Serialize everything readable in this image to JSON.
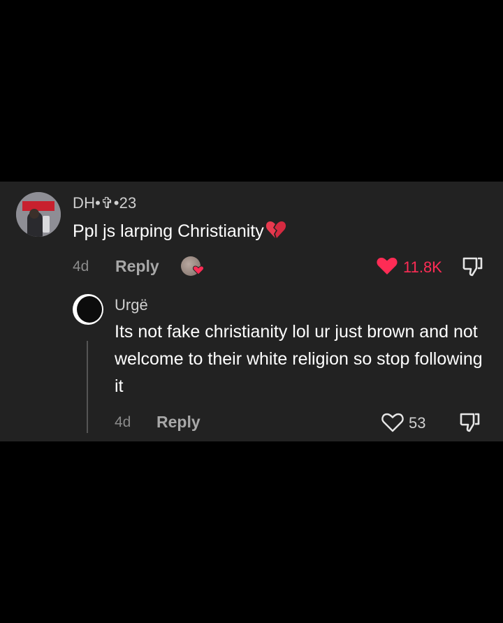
{
  "comment": {
    "username": "DH•✞•23",
    "text": "Ppl js larping Christianity",
    "text_emoji": "broken-heart-icon",
    "time": "4d",
    "reply_label": "Reply",
    "likes": "11.8K",
    "liked": true,
    "like_color": "#fe2c55"
  },
  "reply": {
    "username": "Urgë",
    "text": "Its not fake christianity lol ur just brown and not welcome to their white religion so stop following it",
    "time": "4d",
    "reply_label": "Reply",
    "likes": "53",
    "liked": false
  },
  "colors": {
    "background": "#000000",
    "panel": "#222222",
    "accent": "#fe2c55"
  }
}
